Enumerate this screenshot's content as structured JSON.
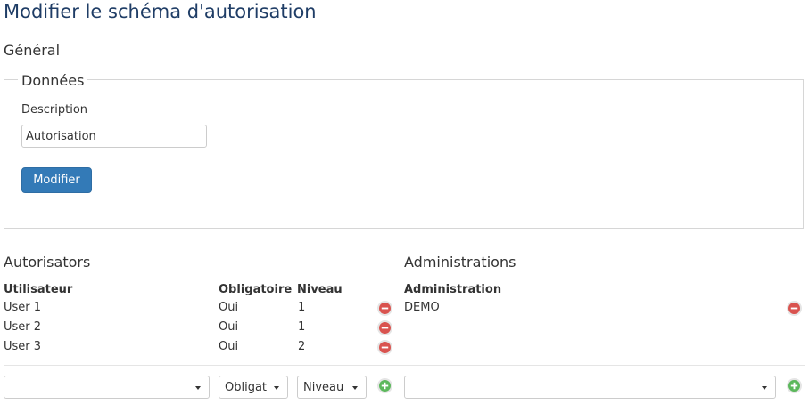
{
  "page": {
    "title": "Modifier le schéma d'autorisation"
  },
  "general": {
    "title": "Général",
    "fieldset_legend": "Données",
    "description_label": "Description",
    "description_value": "Autorisation",
    "modify_button": "Modifier"
  },
  "autorisators": {
    "title": "Autorisators",
    "headers": {
      "user": "Utilisateur",
      "mandatory": "Obligatoire",
      "level": "Niveau"
    },
    "rows": [
      {
        "user": "User 1",
        "mandatory": "Oui",
        "level": "1"
      },
      {
        "user": "User 2",
        "mandatory": "Oui",
        "level": "1"
      },
      {
        "user": "User 3",
        "mandatory": "Oui",
        "level": "2"
      }
    ],
    "add_row": {
      "user_value": "",
      "mandatory_value": "Obligat",
      "level_value": "Niveau"
    }
  },
  "administrations": {
    "title": "Administrations",
    "header": "Administration",
    "rows": [
      {
        "name": "DEMO"
      }
    ],
    "add_row": {
      "value": ""
    }
  },
  "colors": {
    "title": "#1f3d66",
    "primary_button": "#337ab7",
    "remove_icon": "#d9534f",
    "add_icon": "#5cb85c"
  },
  "icons": {
    "remove": "minus-circle-icon",
    "add": "plus-circle-icon",
    "dropdown": "caret-down-icon"
  }
}
